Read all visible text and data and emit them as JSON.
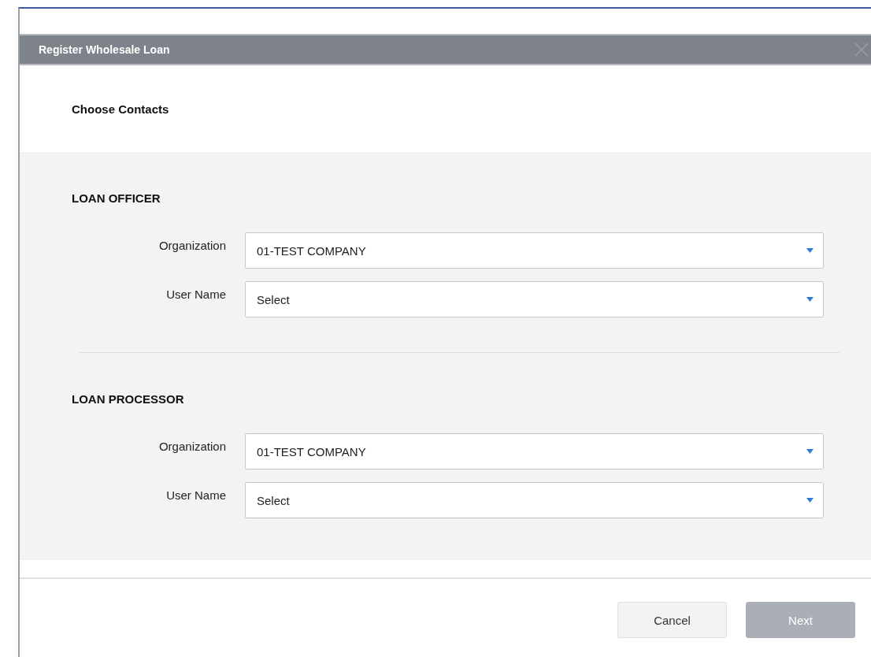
{
  "dialog": {
    "title": "Register Wholesale Loan",
    "step_title": "Choose Contacts"
  },
  "sections": [
    {
      "heading": "LOAN OFFICER",
      "fields": [
        {
          "label": "Organization",
          "value": "01-TEST COMPANY"
        },
        {
          "label": "User Name",
          "value": "Select"
        }
      ]
    },
    {
      "heading": "LOAN PROCESSOR",
      "fields": [
        {
          "label": "Organization",
          "value": "01-TEST COMPANY"
        },
        {
          "label": "User Name",
          "value": "Select"
        }
      ]
    }
  ],
  "buttons": [
    {
      "label": "Cancel",
      "disabled": false
    },
    {
      "label": "Next",
      "disabled": true
    }
  ]
}
